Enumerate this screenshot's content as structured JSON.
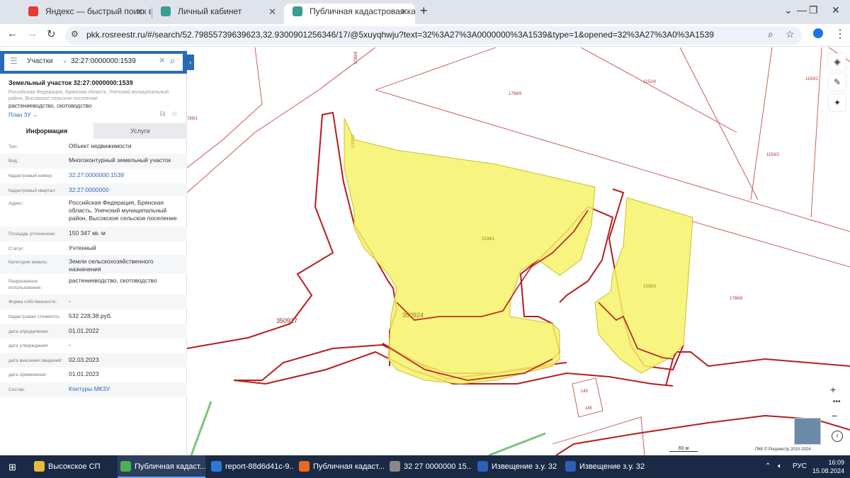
{
  "browser": {
    "tabs": [
      {
        "title": "Яндекс — быстрый поиск в и",
        "active": false
      },
      {
        "title": "Личный кабинет",
        "active": false
      },
      {
        "title": "Публичная кадастровая карта",
        "active": true
      }
    ],
    "new_tab": "+",
    "window_controls": [
      "⌄",
      "—",
      "❐",
      "✕"
    ],
    "url": "pkk.rosreestr.ru/#/search/52.79855739639623,32.9300901256346/17/@5xuyqhwju?text=32%3A27%3A0000000%3A1539&type=1&opened=32%3A27%3A0%3A1539"
  },
  "search": {
    "type": "Участки",
    "value": "32:27:0000000:1539"
  },
  "parcel": {
    "title": "Земельный участок 32:27:0000000:1539",
    "address_short": "Российская Федерация, Брянская область, Унечский муниципальный район, Высокское сельское поселение",
    "use": "растениеводство, скотоводство",
    "plan_link": "План ЗУ →"
  },
  "tabs": {
    "info": "Информация",
    "services": "Услуги"
  },
  "rows": [
    {
      "k": "Тип:",
      "v": "Объект недвижимости",
      "link": false
    },
    {
      "k": "Вид:",
      "v": "Многоконтурный земельный участок",
      "link": false
    },
    {
      "k": "Кадастровый номер:",
      "v": "32:27:0000000:1539",
      "link": true
    },
    {
      "k": "Кадастровый квартал:",
      "v": "32:27:0000000",
      "link": true
    },
    {
      "k": "Адрес:",
      "v": "Российская Федерация, Брянская область, Унечский муниципальный район, Высокское сельское поселение",
      "link": false
    },
    {
      "k": "Площадь уточненная:",
      "v": "150 347 кв. м",
      "link": false
    },
    {
      "k": "Статус:",
      "v": "Учтенный",
      "link": false
    },
    {
      "k": "Категория земель:",
      "v": "Земли сельскохозяйственного назначения",
      "link": false
    },
    {
      "k": "Разрешенное использование:",
      "v": "растениеводство, скотоводство",
      "link": false
    },
    {
      "k": "Форма собственности:",
      "v": "-",
      "link": false
    },
    {
      "k": "Кадастровая стоимость:",
      "v": "532 228,38 руб.",
      "link": false
    },
    {
      "k": "дата определения:",
      "v": "01.01.2022",
      "link": false
    },
    {
      "k": "дата утверждения:",
      "v": "-",
      "link": false
    },
    {
      "k": "дата внесения сведений:",
      "v": "02.03.2023",
      "link": false
    },
    {
      "k": "дата применения:",
      "v": "01.01.2023",
      "link": false
    },
    {
      "k": "Состав:",
      "v": "Контуры МКЗУ",
      "link": true
    }
  ],
  "map_labels": {
    "l1789_8": "1789/8",
    "l1789_9": "1789/9",
    "l1152_4": "1152/4",
    "l1150_2a": "1150/2",
    "l1150_2b": "1150/2",
    "l789_1": "789/1",
    "l1653": "1/1653",
    "l1539_1": "1539/1",
    "l1539_2": "1539/2",
    "l1788_6": "1788/6",
    "l145a": "145",
    "l145b": "145",
    "q350927": "350927",
    "q350924": "350924"
  },
  "map_controls": {
    "zoom_in": "+",
    "zoom_steps": "•••",
    "zoom_out": "−",
    "info": "i",
    "scale": "60 м",
    "copyright": "ПКК © Росреестр 2010-2024"
  },
  "taskbar": {
    "items": [
      {
        "label": "Высокское СП",
        "color": "#e8b93a"
      },
      {
        "label": "Публичная кадаст...",
        "color": "#4caf50"
      },
      {
        "label": "report-88d6d41c-9...",
        "color": "#2b7bd6"
      },
      {
        "label": "Публичная кадаст...",
        "color": "#e66a1f"
      },
      {
        "label": "32  27  0000000  15...",
        "color": "#888888"
      },
      {
        "label": "Извещение з.у. 32 ...",
        "color": "#2b5fb8"
      },
      {
        "label": "Извещение з.у. 32 ...",
        "color": "#2b5fb8"
      }
    ],
    "lang": "РУС",
    "time": "16:09",
    "date": "15.08.2024"
  }
}
